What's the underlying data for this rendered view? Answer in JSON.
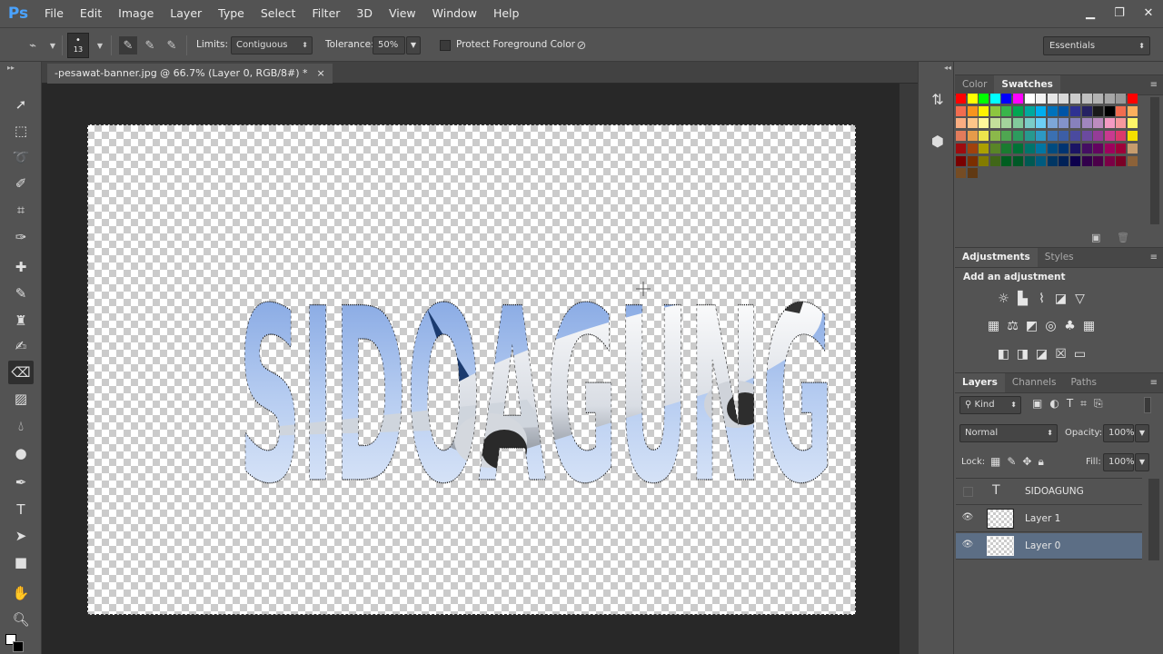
{
  "app": {
    "logo": "Ps"
  },
  "menu": [
    "File",
    "Edit",
    "Image",
    "Layer",
    "Type",
    "Select",
    "Filter",
    "3D",
    "View",
    "Window",
    "Help"
  ],
  "window_controls": {
    "minimize": "▁",
    "restore": "❐",
    "close": "✕"
  },
  "options_bar": {
    "brush_size": "13",
    "limits_label": "Limits:",
    "limits_value": "Contiguous",
    "tolerance_label": "Tolerance:",
    "tolerance_value": "50%",
    "protect_label": "Protect Foreground Color",
    "workspace": "Essentials"
  },
  "document": {
    "tab_title": "-pesawat-banner.jpg @ 66.7% (Layer 0, RGB/8#) *",
    "close_glyph": "×",
    "artwork_text": "SIDOAGUNG"
  },
  "color_panel": {
    "tabs": [
      "Color",
      "Swatches"
    ],
    "active_tab": "Swatches"
  },
  "adjustments_panel": {
    "tabs": [
      "Adjustments",
      "Styles"
    ],
    "title": "Add an adjustment"
  },
  "layers_panel": {
    "tabs": [
      "Layers",
      "Channels",
      "Paths"
    ],
    "filter_kind": "Kind",
    "blend_mode": "Normal",
    "opacity_label": "Opacity:",
    "opacity_value": "100%",
    "lock_label": "Lock:",
    "fill_label": "Fill:",
    "fill_value": "100%",
    "layers": [
      {
        "name": "SIDOAGUNG",
        "type": "text",
        "visible": false
      },
      {
        "name": "Layer 1",
        "type": "pixel",
        "visible": true
      },
      {
        "name": "Layer 0",
        "type": "pixel",
        "visible": true,
        "selected": true
      }
    ]
  },
  "swatch_colors": [
    "#ff0000",
    "#ffff00",
    "#00ff00",
    "#00ffff",
    "#0000ff",
    "#ff00ff",
    "#ffffff",
    "#f2f2f2",
    "#e6e6e6",
    "#d9d9d9",
    "#cccccc",
    "#bfbfbf",
    "#b3b3b3",
    "#a6a6a6",
    "#999999",
    "#ff0000",
    "#f26c4f",
    "#f7941d",
    "#fff200",
    "#8dc63f",
    "#39b54a",
    "#00a651",
    "#00a99d",
    "#00aeef",
    "#0072bc",
    "#0054a6",
    "#2e3192",
    "#262262",
    "#1a1a1a",
    "#000000",
    "#f26c4f",
    "#fbaf5d",
    "#f9ad81",
    "#fdc689",
    "#fff79a",
    "#c4df9b",
    "#a3d39c",
    "#82ca9c",
    "#7accc8",
    "#6dcff6",
    "#7da7d8",
    "#8393ca",
    "#8781bd",
    "#a186be",
    "#bd8cbf",
    "#f49ac2",
    "#f6989d",
    "#fff568",
    "#e27b5b",
    "#e59b4a",
    "#ede44c",
    "#8bb84a",
    "#4fa651",
    "#2d9b5e",
    "#27998f",
    "#2d99c4",
    "#3b70b2",
    "#3c5ea6",
    "#4a4a9f",
    "#6b4a9f",
    "#953c98",
    "#c83a90",
    "#db3a6b",
    "#f4e000",
    "#9e0b0f",
    "#a0410d",
    "#aba000",
    "#598527",
    "#1a7b30",
    "#007236",
    "#00746b",
    "#0076a3",
    "#004b80",
    "#003471",
    "#1b1464",
    "#440e62",
    "#630460",
    "#9e005d",
    "#9e0039",
    "#c69c6d",
    "#790000",
    "#7b2e00",
    "#827b00",
    "#406618",
    "#005e20",
    "#005826",
    "#005952",
    "#005b7f",
    "#003663",
    "#002157",
    "#0d004c",
    "#32004b",
    "#4b0049",
    "#7b0046",
    "#7a0026",
    "#8c6239",
    "#754c24",
    "#603913"
  ]
}
